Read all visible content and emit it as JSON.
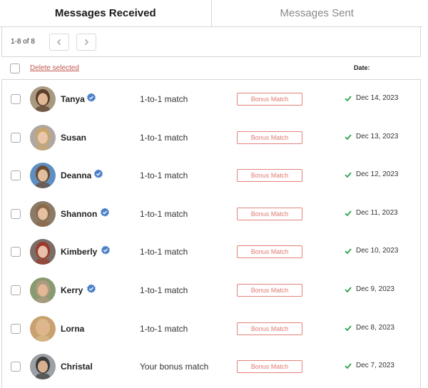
{
  "tabs": [
    {
      "label": "Messages Received",
      "active": true
    },
    {
      "label": "Messages Sent",
      "active": false
    }
  ],
  "pager": {
    "count": "1-8 of 8",
    "prev_icon": "chevron-left-icon",
    "next_icon": "chevron-right-icon"
  },
  "actions": {
    "delete_label": "Delete selected",
    "date_header": "Date:"
  },
  "colors": {
    "accent": "#e07a72",
    "verified": "#4a7fc9",
    "check": "#2aa34a",
    "border": "#d6d6d6"
  },
  "messages": [
    {
      "name": "Tanya",
      "verified": true,
      "type": "1-to-1 match",
      "badge": "Bonus Match",
      "date": "Dec 14, 2023",
      "avatar": {
        "bg": "#a89a80",
        "skin": "#e0b896",
        "hair": "#5a3d2a"
      }
    },
    {
      "name": "Susan",
      "verified": false,
      "type": "1-to-1 match",
      "badge": "Bonus Match",
      "date": "Dec 13, 2023",
      "avatar": {
        "bg": "#b0a8a0",
        "skin": "#eac7aa",
        "hair": "#c9a56b"
      }
    },
    {
      "name": "Deanna",
      "verified": true,
      "type": "1-to-1 match",
      "badge": "Bonus Match",
      "date": "Dec 12, 2023",
      "avatar": {
        "bg": "#5f8ec2",
        "skin": "#e0bfa0",
        "hair": "#6b4a2f"
      }
    },
    {
      "name": "Shannon",
      "verified": true,
      "type": "1-to-1 match",
      "badge": "Bonus Match",
      "date": "Dec 11, 2023",
      "avatar": {
        "bg": "#8c7a68",
        "skin": "#e5c0a2",
        "hair": "#8a6a48"
      }
    },
    {
      "name": "Kimberly",
      "verified": true,
      "type": "1-to-1 match",
      "badge": "Bonus Match",
      "date": "Dec 10, 2023",
      "avatar": {
        "bg": "#7a6c66",
        "skin": "#e8bfa8",
        "hair": "#9a3a2a"
      }
    },
    {
      "name": "Kerry",
      "verified": true,
      "type": "1-to-1 match",
      "badge": "Bonus Match",
      "date": "Dec 9, 2023",
      "avatar": {
        "bg": "#8a9a70",
        "skin": "#e3b896",
        "hair": "#b09a80"
      }
    },
    {
      "name": "Lorna",
      "verified": false,
      "type": "1-to-1 match",
      "badge": "Bonus Match",
      "date": "Dec 8, 2023",
      "avatar": {
        "bg": "#c9a070",
        "skin": "#e2b48e",
        "hair": "#d9b98a"
      }
    },
    {
      "name": "Christal",
      "verified": false,
      "type": "Your bonus match",
      "badge": "Bonus Match",
      "date": "Dec 7, 2023",
      "avatar": {
        "bg": "#9aa0a6",
        "skin": "#d8b090",
        "hair": "#3a3a3a"
      }
    }
  ]
}
